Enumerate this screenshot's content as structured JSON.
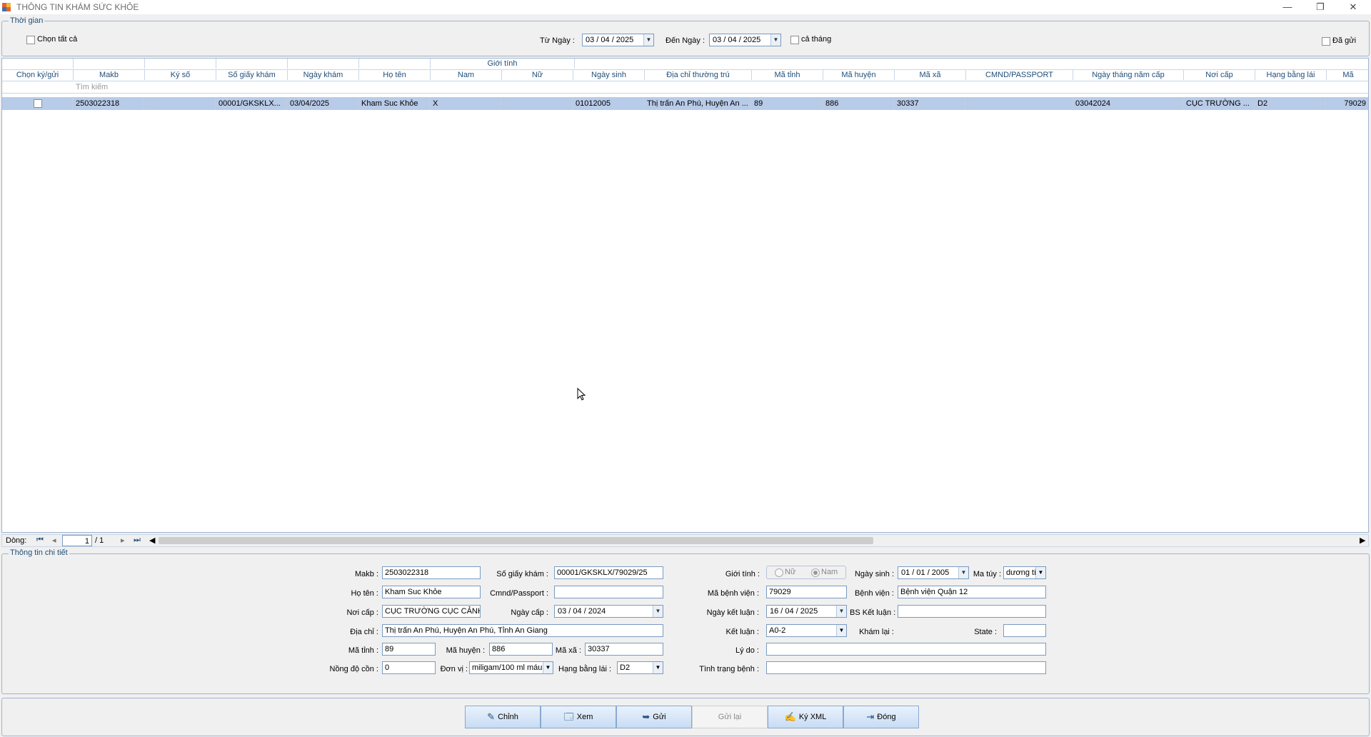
{
  "window": {
    "title": "THÔNG TIN KHÁM SỨC KHỎE",
    "minimize": "—",
    "restore": "❐",
    "close": "✕"
  },
  "filter": {
    "group_label": "Thời gian",
    "select_all": "Chọn tất cả",
    "from_label": "Từ Ngày :",
    "from_value": "03 / 04 / 2025",
    "to_label": "Đến Ngày :",
    "to_value": "03 / 04 / 2025",
    "month_label": "cả tháng",
    "sent_label": "Đã gửi"
  },
  "grid": {
    "band_header": "Giới tính",
    "columns": [
      "Chọn ký/gửi",
      "Makb",
      "Ký số",
      "Số giấy khám",
      "Ngày khám",
      "Họ tên",
      "Nam",
      "Nữ",
      "Ngày sinh",
      "Địa chỉ thường trú",
      "Mã tỉnh",
      "Mã huyện",
      "Mã xã",
      "CMND/PASSPORT",
      "Ngày tháng năm cấp",
      "Nơi cấp",
      "Hạng bằng lái",
      "Mã"
    ],
    "search_placeholder": "Tìm kiếm",
    "rows": [
      [
        "",
        "2503022318",
        "",
        "00001/GKSKLX...",
        "03/04/2025",
        "Kham Suc Khỏe",
        "X",
        "",
        "01012005",
        "Thị trấn An Phú, Huyện An ...",
        "89",
        "886",
        "30337",
        "",
        "03042024",
        "CỤC TRƯỜNG ...",
        "D2",
        "79029"
      ]
    ]
  },
  "pager": {
    "label": "Dòng:",
    "current": "1",
    "total": "/ 1"
  },
  "detail": {
    "group_label": "Thông tin chi tiết",
    "makb_label": "Makb :",
    "makb": "2503022318",
    "so_giay_kham_label": "Số giấy khám :",
    "so_giay_kham": "00001/GKSKLX/79029/25",
    "gioi_tinh_label": "Giới tính :",
    "nu": "Nữ",
    "nam": "Nam",
    "ngay_sinh_label": "Ngày sinh :",
    "ngay_sinh": "01 / 01 / 2005",
    "ma_tuy_label": "Ma túy :",
    "ma_tuy": "dương tí",
    "ho_ten_label": "Họ tên :",
    "ho_ten": "Kham Suc Khỏe",
    "cmnd_label": "Cmnd/Passport :",
    "cmnd": "",
    "ma_bv_label": "Mã bệnh viện :",
    "ma_bv": "79029",
    "benh_vien_label": "Bệnh viện :",
    "benh_vien": "Bệnh viện Quận 12",
    "noi_cap_label": "Nơi cấp :",
    "noi_cap": "CỤC TRƯỜNG CỤC CẢNH",
    "ngay_cap_label": "Ngày cấp :",
    "ngay_cap": "03 / 04 / 2024",
    "ngay_kl_label": "Ngày kết luận :",
    "ngay_kl": "16 / 04 / 2025",
    "bs_kl_label": "BS Kết luận :",
    "bs_kl": "",
    "dia_chi_label": "Địa chỉ :",
    "dia_chi": "Thị trấn An Phú, Huyện An Phú, Tỉnh An Giang",
    "ket_luan_label": "Kết luận :",
    "ket_luan": "A0-2",
    "kham_lai_label": "Khám lại :",
    "state_label": "State :",
    "state": "",
    "ma_tinh_label": "Mã tỉnh :",
    "ma_tinh": "89",
    "ma_huyen_label": "Mã huyện :",
    "ma_huyen": "886",
    "ma_xa_label": "Mã xã :",
    "ma_xa": "30337",
    "ly_do_label": "Lý do :",
    "ly_do": "",
    "nong_do_label": "Nồng độ cồn :",
    "nong_do": "0",
    "don_vi_label": "Đơn vị :",
    "don_vi": "miligam/100 ml máu",
    "hang_bl_label": "Hạng bằng lái :",
    "hang_bl": "D2",
    "tinh_trang_label": "Tình trạng bệnh :",
    "tinh_trang": ""
  },
  "actions": {
    "edit": "Chỉnh",
    "view": "Xem",
    "send": "Gửi",
    "resend": "Gửi lại",
    "sign_xml": "Ký XML",
    "close": "Đóng"
  }
}
